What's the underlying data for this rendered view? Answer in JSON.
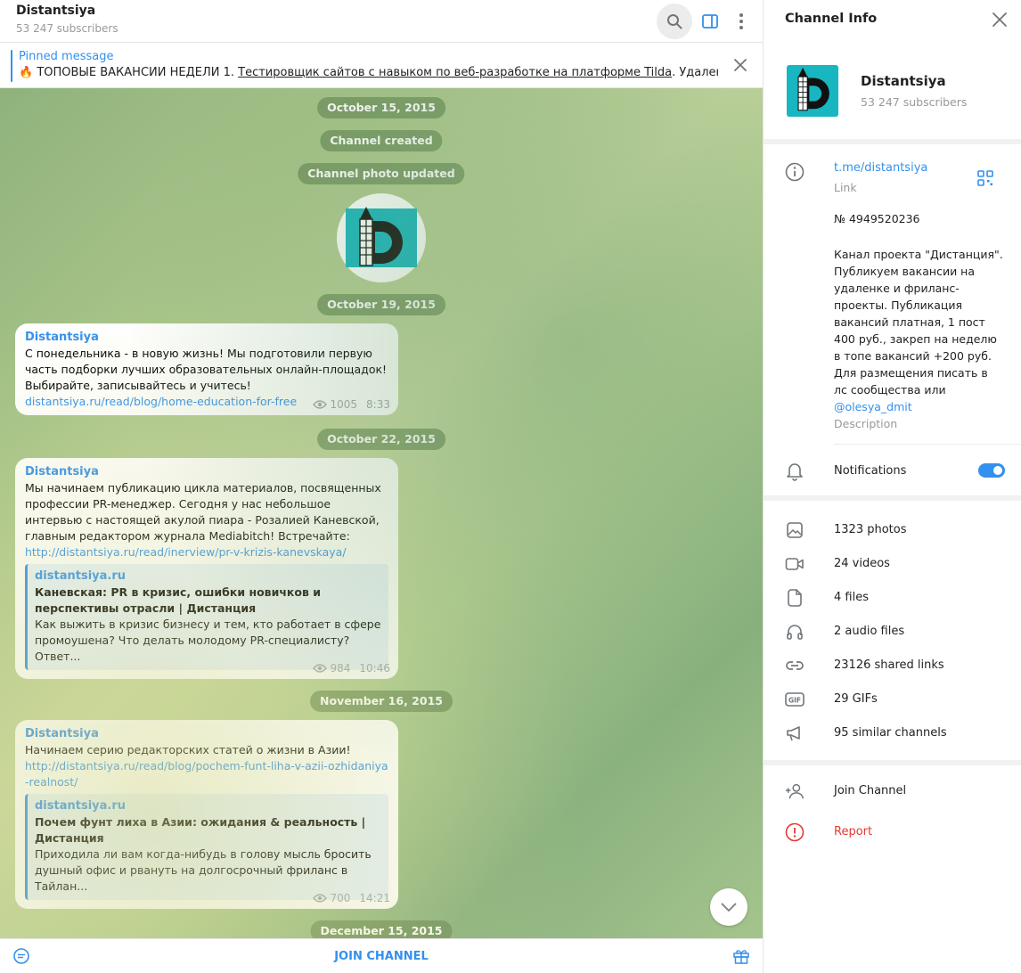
{
  "chat": {
    "title": "Distantsiya",
    "subscribers": "53 247 subscribers",
    "pinned": {
      "title": "Pinned message",
      "prefix": "🔥 ТОПОВЫЕ ВАКАНСИИ НЕДЕЛИ   1. ",
      "link": "Тестировщик сайтов с навыком по веб-разработке на платформе Tilda",
      "suffix": ". Удаленка, ЗП ..."
    },
    "service": {
      "date1": "October 15, 2015",
      "created": "Channel created",
      "photo_updated": "Channel photo updated",
      "date2": "October 19, 2015",
      "date3": "October 22, 2015",
      "date4": "November 16, 2015",
      "date5": "December 15, 2015"
    },
    "messages": [
      {
        "author": "Distantsiya",
        "text": "С понедельника - в новую жизнь! Мы подготовили первую часть подборки лучших образовательных онлайн-площадок! Выбирайте, записывайтесь и учитесь!",
        "link": "distantsiya.ru/read/blog/home-education-for-free",
        "views": "1005",
        "time": "8:33"
      },
      {
        "author": "Distantsiya",
        "text": "Мы начинаем публикацию цикла материалов, посвященных профессии PR-менеджер. Сегодня у нас небольшое интервью с настоящей акулой пиара - Розалией Каневской, главным редактором журнала Mediabitch! Встречайте:",
        "link": "http://distantsiya.ru/read/inerview/pr-v-krizis-kanevskaya/",
        "preview_site": "distantsiya.ru",
        "preview_title": "Каневская: PR в кризис, ошибки новичков и перспективы отрасли | Дистанция",
        "preview_desc": "Как выжить в кризис бизнесу и тем, кто работает в сфере промоушена? Что делать молодому PR-специалисту? Ответ...",
        "views": "984",
        "time": "10:46"
      },
      {
        "author": "Distantsiya",
        "text": "Начинаем серию редакторских статей о жизни в Азии!",
        "link": "http://distantsiya.ru/read/blog/pochem-funt-liha-v-azii-ozhidaniya-realnost/",
        "preview_site": "distantsiya.ru",
        "preview_title": "Почем фунт лиха в Азии: ожидания & реальность | Дистанция",
        "preview_desc": "Приходила ли вам когда-нибудь в голову мысль бросить душный офис и рвануть на долгосрочный фриланс в Тайлан...",
        "views": "700",
        "time": "14:21"
      }
    ],
    "join_label": "JOIN CHANNEL"
  },
  "info": {
    "title": "Channel Info",
    "name": "Distantsiya",
    "subscribers": "53 247 subscribers",
    "link": "t.me/distantsiya",
    "link_caption": "Link",
    "id": "№ 4949520236",
    "description": "Канал проекта \"Дистанция\". Публикуем вакансии на удаленке и фриланс-проекты. Публикация вакансий платная, 1 пост 400 руб., закреп на неделю в топе вакансий +200 руб.\nДля размещения писать в лс сообщества или",
    "mention": "@olesya_dmit",
    "description_caption": "Description",
    "notifications": "Notifications",
    "notifications_on": true,
    "media": {
      "photos": "1323 photos",
      "videos": "24 videos",
      "files": "4 files",
      "audio": "2 audio files",
      "links": "23126 shared links",
      "gifs": "29 GIFs",
      "similar": "95 similar channels"
    },
    "join": "Join Channel",
    "report": "Report"
  },
  "colors": {
    "accent": "#3390ec",
    "danger": "#e53935",
    "logo_teal": "#17b6c0"
  }
}
